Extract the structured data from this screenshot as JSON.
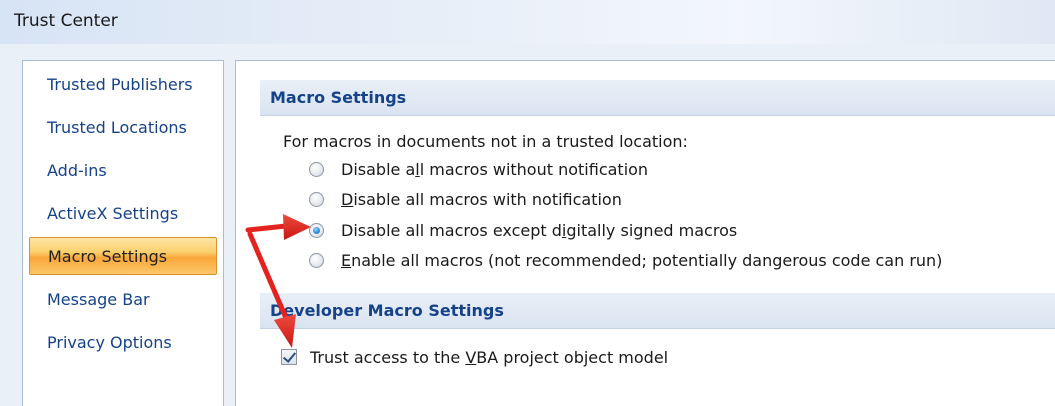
{
  "window": {
    "title": "Trust Center"
  },
  "sidebar": {
    "items": [
      {
        "label": "Trusted Publishers",
        "active": false
      },
      {
        "label": "Trusted Locations",
        "active": false
      },
      {
        "label": "Add-ins",
        "active": false
      },
      {
        "label": "ActiveX Settings",
        "active": false
      },
      {
        "label": "Macro Settings",
        "active": true
      },
      {
        "label": "Message Bar",
        "active": false
      },
      {
        "label": "Privacy Options",
        "active": false
      }
    ]
  },
  "macro_settings": {
    "header": "Macro Settings",
    "intro": "For macros in documents not in a trusted location:",
    "options": [
      {
        "label_pre": "Disable a",
        "label_u": "l",
        "label_post": "l macros without notification",
        "checked": false
      },
      {
        "label_pre": "",
        "label_u": "D",
        "label_post": "isable all macros with notification",
        "checked": false
      },
      {
        "label_pre": "Disable all macros except d",
        "label_u": "i",
        "label_post": "gitally signed macros",
        "checked": true
      },
      {
        "label_pre": "",
        "label_u": "E",
        "label_post": "nable all macros (not recommended; potentially dangerous code can run)",
        "checked": false
      }
    ]
  },
  "developer_settings": {
    "header": "Developer Macro Settings",
    "checkbox": {
      "label_pre": "Trust access to the ",
      "label_u": "V",
      "label_post": "BA project object model",
      "checked": true
    }
  },
  "colors": {
    "accent_text": "#15428b",
    "active_item": "#f9a63a",
    "annotation_arrow": "#e4231f"
  }
}
